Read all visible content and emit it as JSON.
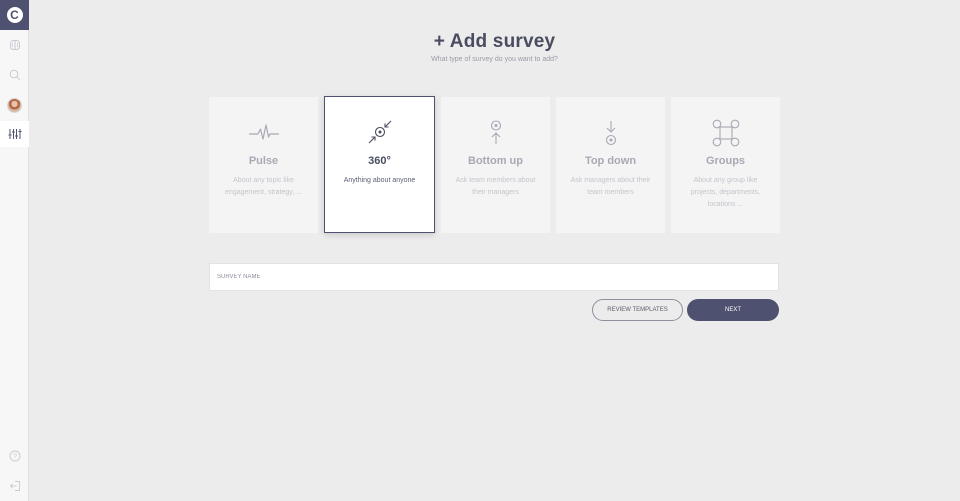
{
  "sidebar": {
    "logo_letter": "C",
    "items": [
      {
        "name": "groups",
        "icon": "brain-icon"
      },
      {
        "name": "search",
        "icon": "search-icon"
      },
      {
        "name": "profile",
        "icon": "avatar"
      },
      {
        "name": "surveys",
        "icon": "sliders-icon",
        "active": true
      }
    ],
    "bottom_items": [
      {
        "name": "help",
        "icon": "help-icon",
        "glyph": "?"
      },
      {
        "name": "logout",
        "icon": "logout-icon"
      }
    ]
  },
  "header": {
    "title": "+ Add survey",
    "subtitle": "What type of survey do you want to add?"
  },
  "survey_types": [
    {
      "name": "Pulse",
      "description": "About any topic like engagement, strategy, ...",
      "icon": "pulse-icon",
      "selected": false
    },
    {
      "name": "360°",
      "description": "Anything about anyone",
      "icon": "arrows-in-icon",
      "selected": true
    },
    {
      "name": "Bottom up",
      "description": "Ask team members about their managers",
      "icon": "arrow-up-icon",
      "selected": false
    },
    {
      "name": "Top down",
      "description": "Ask managers about their team members",
      "icon": "arrow-down-icon",
      "selected": false
    },
    {
      "name": "Groups",
      "description": "About any group like projects, departments, locations ...",
      "icon": "network-icon",
      "selected": false
    }
  ],
  "form": {
    "survey_name_placeholder": "SURVEY NAME",
    "survey_name_value": ""
  },
  "actions": {
    "review_label": "REVIEW TEMPLATES",
    "next_label": "NEXT"
  },
  "colors": {
    "primary": "#4e5170",
    "background": "#ececec",
    "card": "#f4f4f4"
  }
}
